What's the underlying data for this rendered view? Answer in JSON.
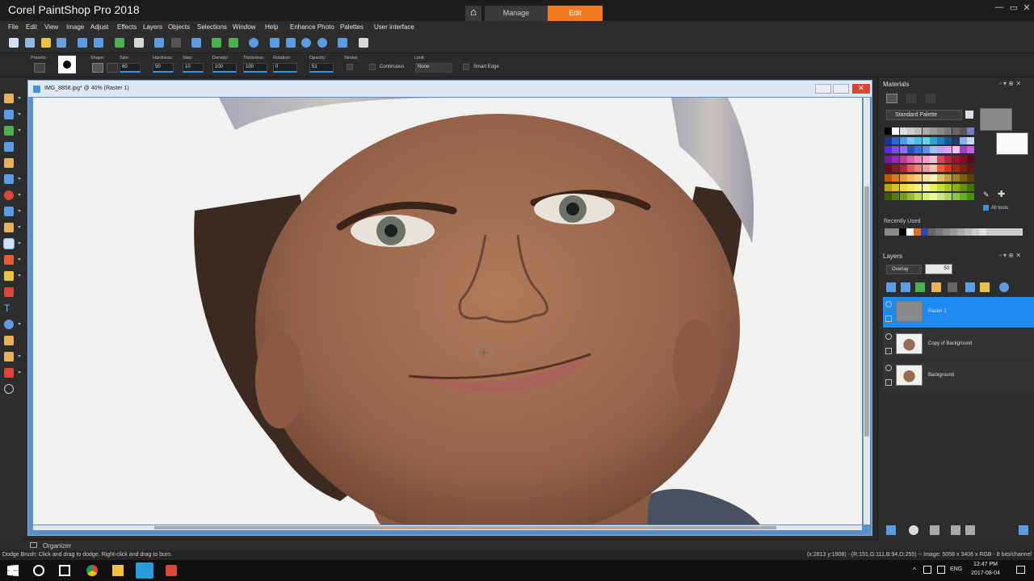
{
  "window": {
    "title": "Corel PaintShop Pro 2018",
    "minimize": "—",
    "maximize": "▭",
    "close": "✕",
    "home_glyph": "⌂",
    "tabs": [
      {
        "label": "Manage"
      },
      {
        "label": "Edit"
      }
    ],
    "accent_color": "#f27a22"
  },
  "menu": [
    "File",
    "Edit",
    "View",
    "Image",
    "Adjust",
    "Effects",
    "Layers",
    "Objects",
    "Selections",
    "Window",
    "Help",
    "Enhance Photo",
    "Palettes",
    "User interface"
  ],
  "tool_options": {
    "presets_label": "Presets:",
    "shape_label": "Shape:",
    "size_label": "Size:",
    "size_value": "60",
    "hardness_label": "Hardness:",
    "hardness_value": "50",
    "step_label": "Step:",
    "step_value": "10",
    "density_label": "Density:",
    "density_value": "100",
    "thickness_label": "Thickness:",
    "thickness_value": "100",
    "rotation_label": "Rotation:",
    "rotation_value": "0",
    "opacity_label": "Opacity:",
    "opacity_value": "51",
    "stroke_label": "Stroke:",
    "continuous_label": "Continuous",
    "limit_label": "Limit:",
    "limit_value": "None",
    "smart_edge_label": "Smart Edge"
  },
  "document": {
    "title": "IMG_8858.jpg* @  40% (Raster 1)"
  },
  "materials": {
    "title": "Materials",
    "palette": "Standard Palette",
    "recently_used": "Recently Used",
    "all_tools": "All tools",
    "foreground_color": "#8a8a8a",
    "background_color": "#fafafa"
  },
  "layers": {
    "title": "Layers",
    "blend_mode": "Overlay",
    "opacity": "50",
    "items": [
      {
        "name": "Raster 1"
      },
      {
        "name": "Copy of Background"
      },
      {
        "name": "Background"
      }
    ]
  },
  "organizer": {
    "label": "Organizer"
  },
  "status": {
    "left": "Dodge Brush: Click and drag to dodge. Right-click and drag to burn.",
    "right": "(x:2813 y:1908) - (R:151,G:111,B:94,O:255) -- Image:  5058 x 3406 x RGB - 8 bits/channel"
  },
  "taskbar": {
    "lang": "ENG",
    "time": "12:47 PM",
    "date": "2017-08-04"
  }
}
